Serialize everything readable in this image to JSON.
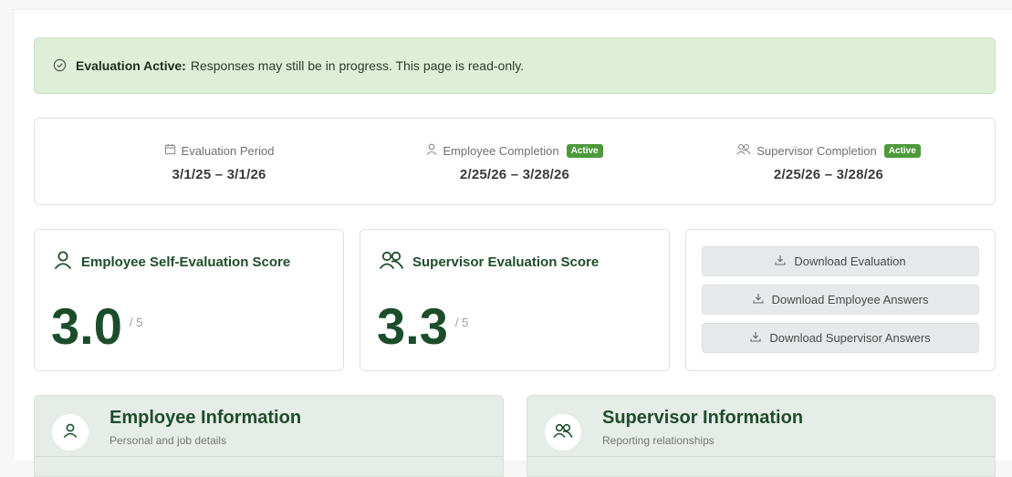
{
  "banner": {
    "title": "Evaluation Active:",
    "message": "Responses may still be in progress. This page is read-only.",
    "icon": "check-circle-icon"
  },
  "periods": [
    {
      "label": "Evaluation Period",
      "value": "3/1/25 – 3/1/26",
      "icon": "calendar-icon",
      "badge": ""
    },
    {
      "label": "Employee Completion",
      "value": "2/25/26 – 3/28/26",
      "icon": "user-icon",
      "badge": "Active"
    },
    {
      "label": "Supervisor Completion",
      "value": "2/25/26 – 3/28/26",
      "icon": "users-icon",
      "badge": "Active"
    }
  ],
  "scores": {
    "employee": {
      "title": "Employee Self-Evaluation Score",
      "value": "3.0",
      "max": "/ 5",
      "icon": "user-icon"
    },
    "supervisor": {
      "title": "Supervisor Evaluation Score",
      "value": "3.3",
      "max": "/ 5",
      "icon": "users-icon"
    }
  },
  "downloads": [
    {
      "label": "Download Evaluation",
      "icon": "download-icon"
    },
    {
      "label": "Download Employee Answers",
      "icon": "download-icon"
    },
    {
      "label": "Download Supervisor Answers",
      "icon": "download-icon"
    }
  ],
  "info": {
    "employee": {
      "title": "Employee Information",
      "subtitle": "Personal and job details",
      "icon": "user-icon"
    },
    "supervisor": {
      "title": "Supervisor Information",
      "subtitle": "Reporting relationships",
      "icon": "users-icon"
    }
  },
  "colors": {
    "accent": "#1b4d2b",
    "badge": "#4c9a3a",
    "banner_bg": "#dfeed7"
  }
}
